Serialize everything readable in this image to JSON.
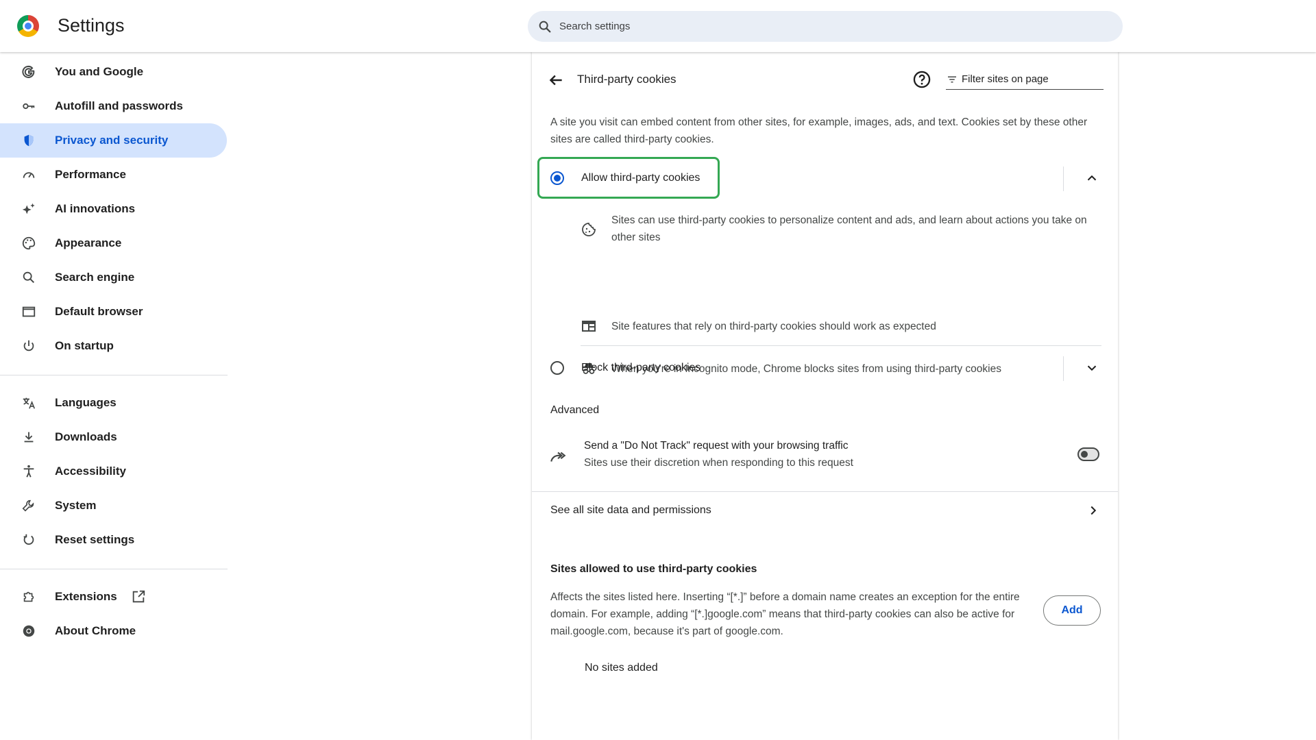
{
  "header": {
    "title": "Settings",
    "search_placeholder": "Search settings"
  },
  "sidebar": {
    "items": [
      {
        "label": "You and Google",
        "icon": "google-g-icon"
      },
      {
        "label": "Autofill and passwords",
        "icon": "key-icon"
      },
      {
        "label": "Privacy and security",
        "icon": "shield-icon",
        "active": true
      },
      {
        "label": "Performance",
        "icon": "speedometer-icon"
      },
      {
        "label": "AI innovations",
        "icon": "sparkle-icon"
      },
      {
        "label": "Appearance",
        "icon": "palette-icon"
      },
      {
        "label": "Search engine",
        "icon": "search-icon"
      },
      {
        "label": "Default browser",
        "icon": "browser-window-icon"
      },
      {
        "label": "On startup",
        "icon": "power-icon"
      },
      {
        "label": "Languages",
        "icon": "translate-icon"
      },
      {
        "label": "Downloads",
        "icon": "download-icon"
      },
      {
        "label": "Accessibility",
        "icon": "accessibility-icon"
      },
      {
        "label": "System",
        "icon": "wrench-icon"
      },
      {
        "label": "Reset settings",
        "icon": "reset-icon"
      },
      {
        "label": "Extensions",
        "icon": "puzzle-icon"
      },
      {
        "label": "About Chrome",
        "icon": "chrome-icon"
      }
    ]
  },
  "page": {
    "title": "Third-party cookies",
    "filter_placeholder": "Filter sites on page",
    "description": "A site you visit can embed content from other sites, for example, images, ads, and text. Cookies set by these other sites are called third-party cookies.",
    "options": {
      "allow": {
        "label": "Allow third-party cookies",
        "selected": true,
        "expanded": true,
        "bullets": [
          "Sites can use third-party cookies to personalize content and ads, and learn about actions you take on other sites",
          "Site features that rely on third-party cookies should work as expected",
          "When you're in Incognito mode, Chrome blocks sites from using third-party cookies"
        ]
      },
      "block": {
        "label": "Block third-party cookies",
        "selected": false,
        "expanded": false
      }
    },
    "advanced": {
      "title": "Advanced",
      "dnt_title": "Send a \"Do Not Track\" request with your browsing traffic",
      "dnt_subtitle": "Sites use their discretion when responding to this request",
      "dnt_enabled": false
    },
    "site_data_label": "See all site data and permissions",
    "allowed": {
      "title": "Sites allowed to use third-party cookies",
      "description": "Affects the sites listed here. Inserting “[*.]” before a domain name creates an exception for the entire domain. For example, adding “[*.]google.com” means that third-party cookies can also be active for mail.google.com, because it's part of google.com.",
      "add_label": "Add",
      "empty_label": "No sites added"
    }
  },
  "colors": {
    "accent": "#0b57d0",
    "active_nav_bg": "#d3e3fd",
    "search_bg": "#e9eef6",
    "highlight": "#34a853"
  }
}
